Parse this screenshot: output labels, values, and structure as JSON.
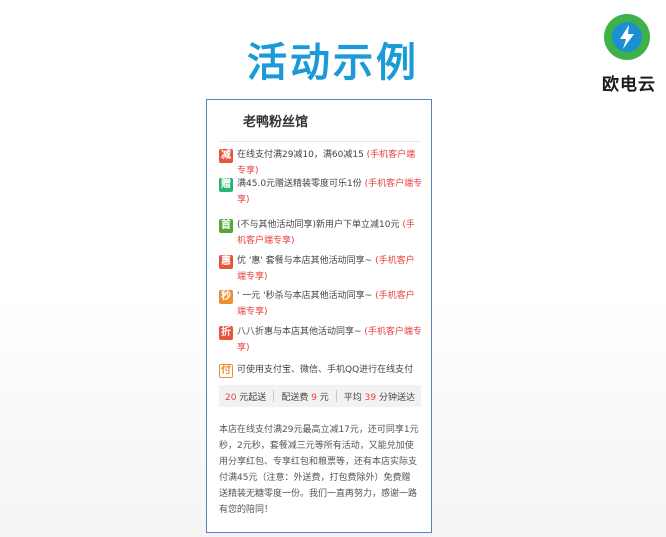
{
  "slide": {
    "title": "活动示例",
    "title_color": "#1a9bd7"
  },
  "logo": {
    "brand": "欧电云",
    "colors": {
      "ring": "#3eb14a",
      "center": "#1b8fd3"
    }
  },
  "store": {
    "name": "老鸭粉丝馆"
  },
  "promos": [
    {
      "badge": "减",
      "badge_color": "#e8553c",
      "text": "在线支付满29减10，满60减15 ",
      "exclusive": "(手机客户端专享)"
    },
    {
      "badge": "赠",
      "badge_color": "#29b472",
      "text": "满45.0元赠送精装零度可乐1份 ",
      "exclusive": "(手机客户端专享)"
    },
    {
      "badge": "首",
      "badge_color": "#54a83a",
      "text": "(不与其他活动同享)新用户下单立减10元 ",
      "exclusive": "(手机客户端专享)"
    },
    {
      "badge": "惠",
      "badge_color": "#e8553c",
      "text": "优 '惠' 套餐与本店其他活动同享~ ",
      "exclusive": "(手机客户端专享)"
    },
    {
      "badge": "秒",
      "badge_color": "#f08d33",
      "text": "' 一元 '秒杀与本店其他活动同享~ ",
      "exclusive": "(手机客户端专享)"
    },
    {
      "badge": "折",
      "badge_color": "#e8553c",
      "text": "八八折惠与本店其他活动同享~ ",
      "exclusive": "(手机客户端专享)"
    },
    {
      "badge": "付",
      "badge_color": "#f08d33",
      "text": "可使用支付宝、微信、手机QQ进行在线支付",
      "exclusive": ""
    }
  ],
  "stats": {
    "min_order_value": "20",
    "min_order_label": " 元起送",
    "delivery_fee_label": "配送费 ",
    "delivery_fee_value": "9",
    "delivery_fee_unit": " 元",
    "avg_label": "平均 ",
    "avg_value": "39",
    "avg_unit": " 分钟送达"
  },
  "description": "本店在线支付满29元最高立减17元，还可同享1元秒，2元秒，套餐减三元等所有活动，又能兑加使用分享红包、专享红包和粮票等，还有本店实际支付满45元（注意：外送费，打包费除外）免费赠送精装无糖零度一份。我们一直再努力，感谢一路有您的陪同！"
}
